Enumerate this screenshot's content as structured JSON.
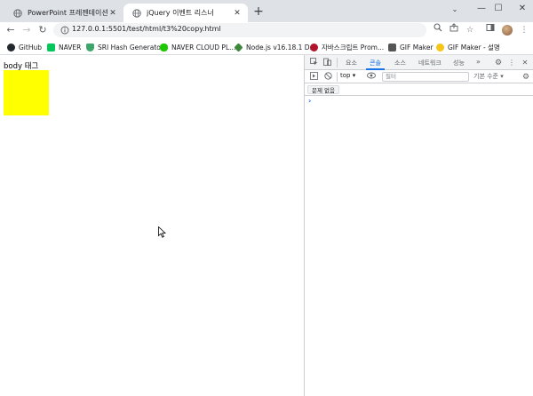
{
  "tabs": [
    {
      "title": "PowerPoint 프레젠테이션",
      "close": "✕"
    },
    {
      "title": "jQuery 이벤트 리스너",
      "close": "✕"
    }
  ],
  "new_tab": "+",
  "window_controls": {
    "minimize": "—",
    "maximize": "☐",
    "close": "✕"
  },
  "nav": {
    "back": "←",
    "forward": "→",
    "reload": "↻"
  },
  "address": {
    "url": "127.0.0.1:5501/test/html/t3%20copy.html"
  },
  "bookmarks": [
    {
      "label": "GitHub",
      "color": "#24292f"
    },
    {
      "label": "NAVER",
      "color": "#03c75a"
    },
    {
      "label": "SRI Hash Generator",
      "color": "#3ea66b"
    },
    {
      "label": "NAVER CLOUD PL...",
      "color": "#1ec800"
    },
    {
      "label": "Node.js v16.18.1 D...",
      "color": "#3c873a"
    },
    {
      "label": "자바스크립트 Prom...",
      "color": "#b3142c"
    },
    {
      "label": "GIF Maker",
      "color": "#555555"
    },
    {
      "label": "GIF Maker - 설명",
      "color": "#f5c518"
    }
  ],
  "page": {
    "body_label": "body 태그",
    "box_color": "#ffff00"
  },
  "devtools": {
    "tabs": [
      "요소",
      "콘솔",
      "소스",
      "네트워크",
      "성능"
    ],
    "active_tab": "콘솔",
    "more": "»",
    "context": "top ▾",
    "filter_placeholder": "필터",
    "level": "기본 수준 ▾",
    "issues": "문제 없음",
    "prompt": "›",
    "accent": "#1a73e8"
  }
}
